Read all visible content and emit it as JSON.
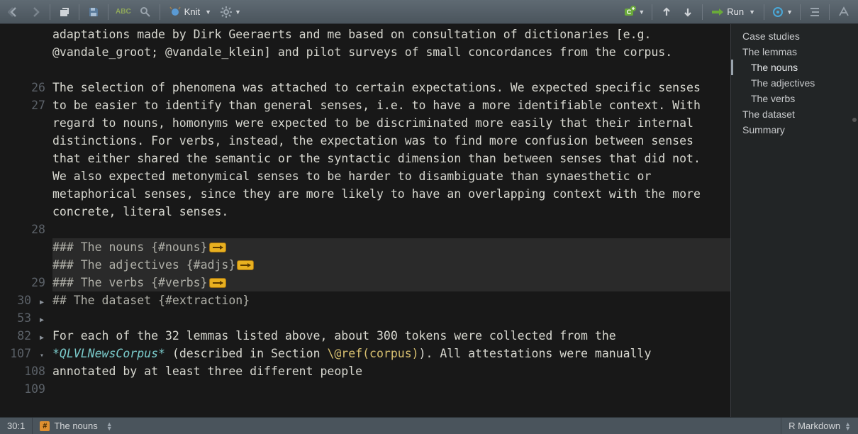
{
  "toolbar": {
    "knit_label": "Knit"
  },
  "run": {
    "label": "Run"
  },
  "outline": {
    "items": [
      {
        "label": "Case studies",
        "level": 1,
        "active": false
      },
      {
        "label": "The lemmas",
        "level": 1,
        "active": false
      },
      {
        "label": "The nouns",
        "level": 2,
        "active": true
      },
      {
        "label": "The adjectives",
        "level": 2,
        "active": false
      },
      {
        "label": "The verbs",
        "level": 2,
        "active": false
      },
      {
        "label": "The dataset",
        "level": 1,
        "active": false
      },
      {
        "label": "Summary",
        "level": 1,
        "active": false
      }
    ]
  },
  "editor": {
    "lines": {
      "l25": "adaptations made by Dirk Geeraerts and me based on consultation of dictionaries [e.g. @vandale_groot; @vandale_klein] and pilot surveys of small concordances from the corpus.",
      "l27": "The selection of phenomena was attached to certain expectations. We expected specific senses to be easier to identify than general senses, i.e. to have a more identifiable context. With regard to nouns, homonyms were expected to be discriminated more easily that their internal distinctions. For verbs, instead, the expectation was to find more confusion between senses that either shared the semantic or the syntactic dimension than between senses that did not.",
      "l28": "We also expected metonymical senses to be harder to disambiguate than synaesthetic or metaphorical senses, since they are more likely to have an overlapping context with the more concrete, literal senses.",
      "h30": "### The nouns {#nouns}",
      "h53": "### The adjectives {#adjs}",
      "h82": "### The verbs {#verbs}",
      "h107_pre": "## The dataset ",
      "h107_brace": "{#extraction}",
      "l109_a": "For each of the 32 lemmas listed above, about 300 tokens were collected from the ",
      "l109_ital": "*QLVLNewsCorpus*",
      "l109_b": " (described in Section ",
      "l109_ref": "\\@ref(corpus)",
      "l109_c": "). All attestations were manually annotated by at least three different people"
    },
    "line_numbers": {
      "n26": "26",
      "n27": "27",
      "n28": "28",
      "n29": "29",
      "n30": "30",
      "n53": "53",
      "n82": "82",
      "n107": "107",
      "n108": "108",
      "n109": "109"
    }
  },
  "status": {
    "cursor": "30:1",
    "crumb": "The nouns",
    "lang": "R Markdown"
  }
}
